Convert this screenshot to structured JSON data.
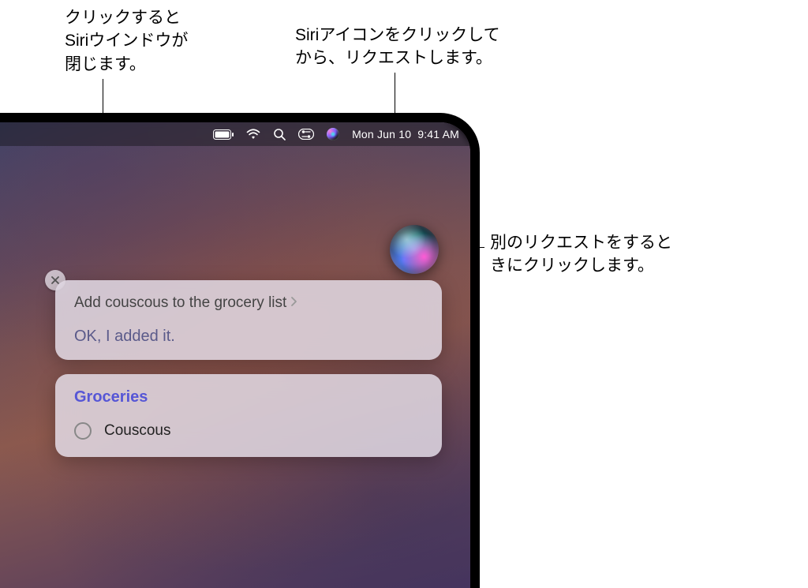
{
  "callouts": {
    "close": "クリックすると\nSiriウインドウが\n閉じます。",
    "menubar_siri": "Siriアイコンをクリックして\nから、リクエストします。",
    "orb": "別のリクエストをすると\nきにクリックします。"
  },
  "menubar": {
    "date": "Mon Jun 10",
    "time": "9:41 AM"
  },
  "siri": {
    "request": "Add couscous to the grocery list",
    "response": "OK, I added it.",
    "list_title": "Groceries",
    "items": [
      {
        "label": "Couscous"
      }
    ]
  }
}
